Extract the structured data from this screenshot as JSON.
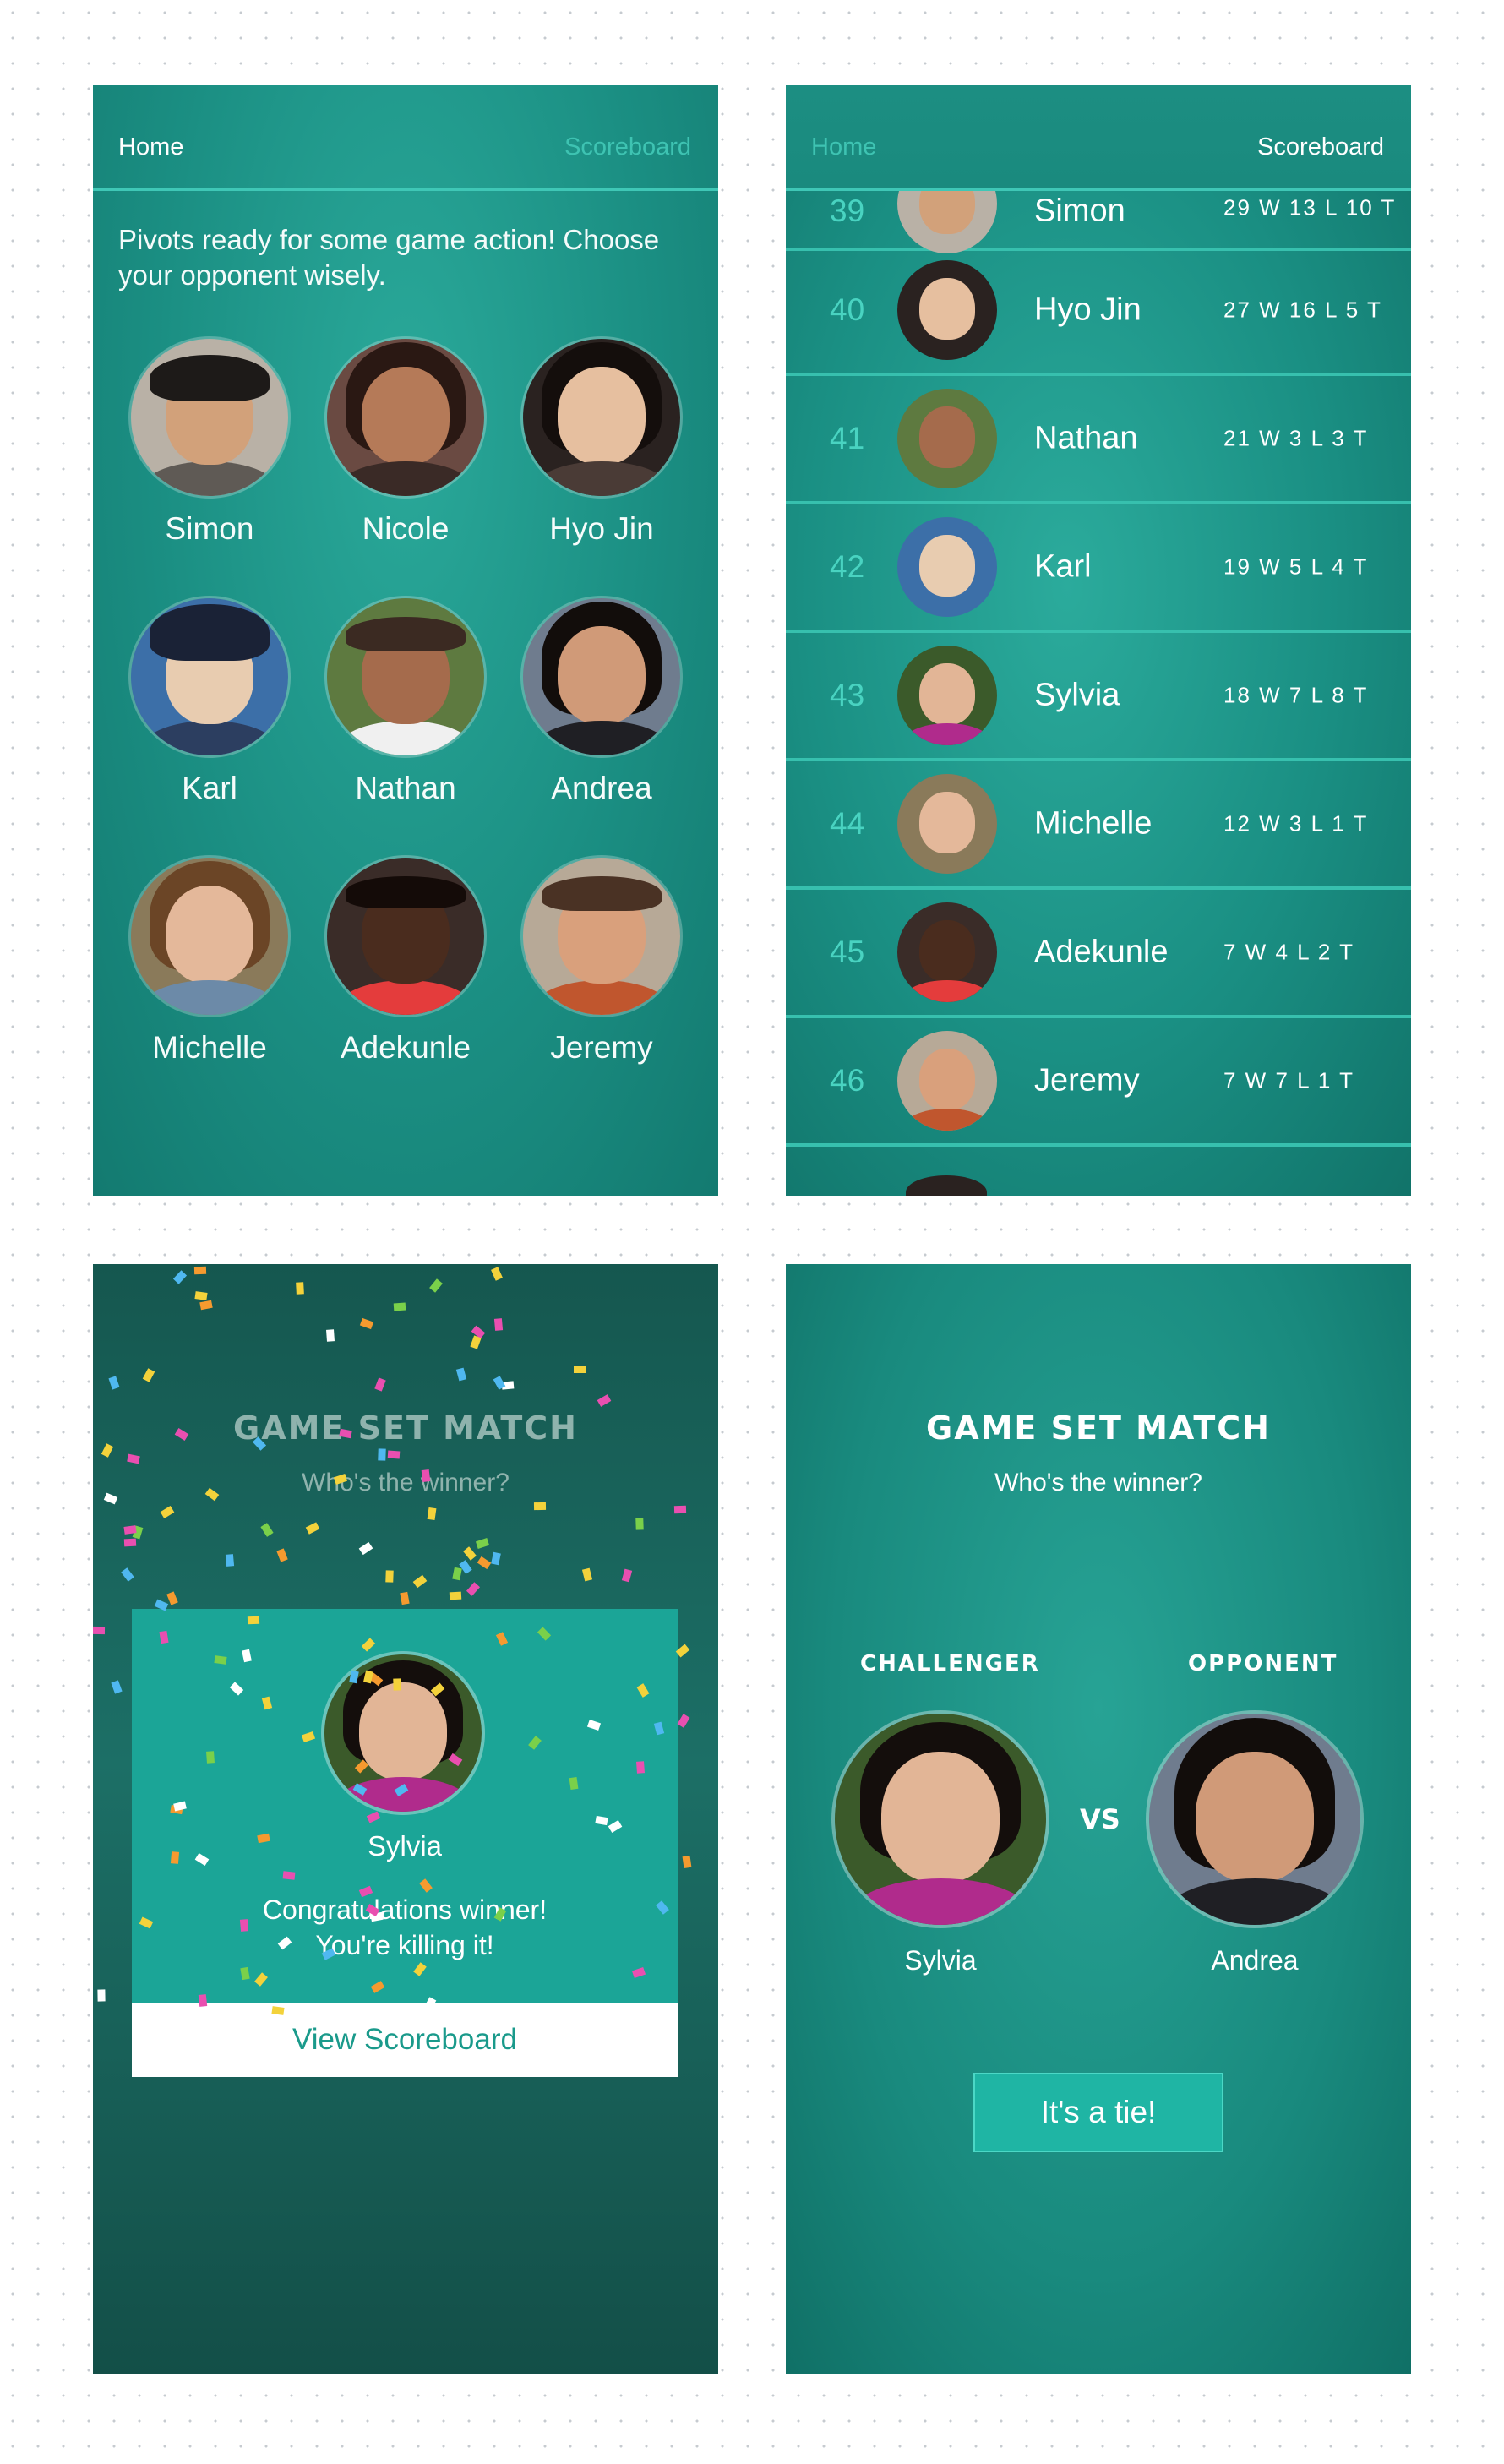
{
  "colors": {
    "accent": "#1fb5a4",
    "nav_dim": "#3ec3b2",
    "rank": "#49d3c1",
    "button_text": "#1a9a8b"
  },
  "screen1": {
    "nav": {
      "home": "Home",
      "scoreboard": "Scoreboard"
    },
    "intro": "Pivots ready for some game action! Choose your opponent wisely.",
    "players": [
      {
        "name": "Simon"
      },
      {
        "name": "Nicole"
      },
      {
        "name": "Hyo Jin"
      },
      {
        "name": "Karl"
      },
      {
        "name": "Nathan"
      },
      {
        "name": "Andrea"
      },
      {
        "name": "Michelle"
      },
      {
        "name": "Adekunle"
      },
      {
        "name": "Jeremy"
      }
    ]
  },
  "screen2": {
    "nav": {
      "home": "Home",
      "scoreboard": "Scoreboard"
    },
    "rows": [
      {
        "rank": "39",
        "name": "Simon",
        "record": "29 W  13 L  10 T"
      },
      {
        "rank": "40",
        "name": "Hyo Jin",
        "record": "27 W  16 L  5 T"
      },
      {
        "rank": "41",
        "name": "Nathan",
        "record": "21 W  3 L  3 T"
      },
      {
        "rank": "42",
        "name": "Karl",
        "record": "19 W  5 L  4 T"
      },
      {
        "rank": "43",
        "name": "Sylvia",
        "record": "18 W  7 L  8 T"
      },
      {
        "rank": "44",
        "name": "Michelle",
        "record": "12 W  3 L  1 T"
      },
      {
        "rank": "45",
        "name": "Adekunle",
        "record": "7 W  4 L  2 T"
      },
      {
        "rank": "46",
        "name": "Jeremy",
        "record": "7 W  7 L  1 T"
      }
    ]
  },
  "screen3": {
    "title": "GAME SET MATCH",
    "subtitle": "Who's the winner?",
    "winner": "Sylvia",
    "message_line1": "Congratulations winner!",
    "message_line2": "You're killing it!",
    "button": "View Scoreboard"
  },
  "screen4": {
    "title": "GAME SET MATCH",
    "subtitle": "Who's the winner?",
    "challenger_label": "CHALLENGER",
    "opponent_label": "OPPONENT",
    "challenger": "Sylvia",
    "opponent": "Andrea",
    "vs": "VS",
    "tie_button": "It's a tie!"
  }
}
